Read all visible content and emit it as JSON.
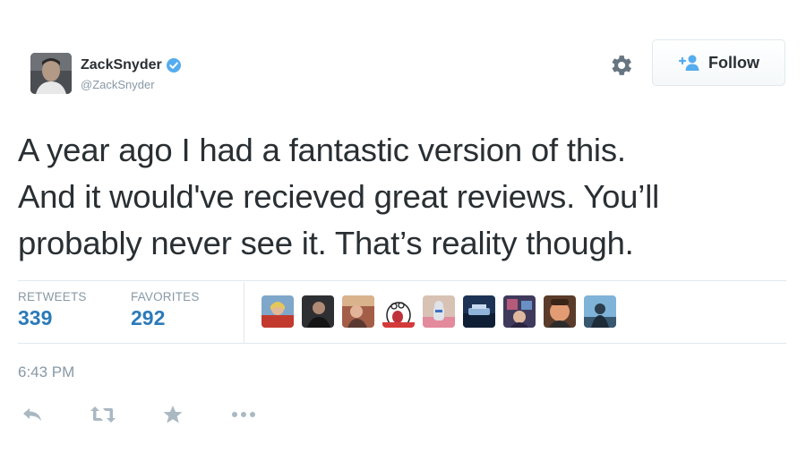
{
  "user": {
    "display_name": "ZackSnyder",
    "handle": "@ZackSnyder",
    "verified": true,
    "verified_color": "#55acee"
  },
  "follow_button": {
    "label": "Follow",
    "icon": "add-user-icon",
    "icon_color": "#55acee"
  },
  "settings_icon": "gear-icon",
  "tweet": {
    "text": "A year ago I had a fantastic version of this.\nAnd it would've recieved great reviews. You’ll\nprobably never see it. That’s reality though."
  },
  "stats": {
    "retweets_label": "RETWEETS",
    "retweets_count": "339",
    "favorites_label": "FAVORITES",
    "favorites_count": "292",
    "count_color": "#2b7bb9"
  },
  "favoriters": [
    {
      "name": "favoriter-avatar-1"
    },
    {
      "name": "favoriter-avatar-2"
    },
    {
      "name": "favoriter-avatar-3"
    },
    {
      "name": "favoriter-avatar-4"
    },
    {
      "name": "favoriter-avatar-5"
    },
    {
      "name": "favoriter-avatar-6"
    },
    {
      "name": "favoriter-avatar-7"
    },
    {
      "name": "favoriter-avatar-8"
    },
    {
      "name": "favoriter-avatar-9"
    }
  ],
  "timestamp": "6:43 PM",
  "actions": [
    "reply-icon",
    "retweet-icon",
    "favorite-icon",
    "more-icon"
  ]
}
